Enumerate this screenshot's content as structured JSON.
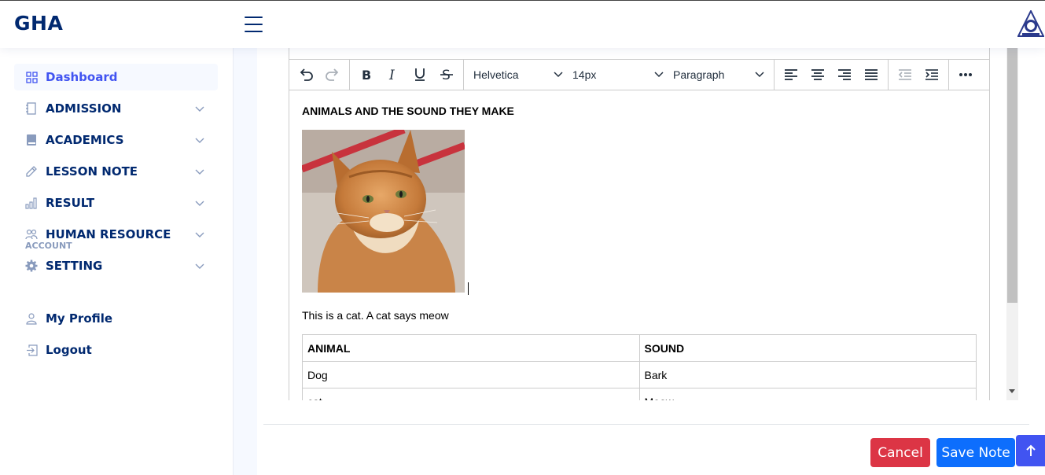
{
  "header": {
    "logo": "GHA"
  },
  "sidebar": {
    "items": [
      {
        "label": "Dashboard",
        "icon": "grid-icon",
        "active": true
      },
      {
        "label": "ADMISSION",
        "icon": "journal-icon"
      },
      {
        "label": "ACADEMICS",
        "icon": "book-icon"
      },
      {
        "label": "LESSON NOTE",
        "icon": "pencil-icon"
      },
      {
        "label": "RESULT",
        "icon": "bar-chart-icon"
      },
      {
        "label": "HUMAN RESOURCE",
        "icon": "people-icon"
      },
      {
        "label": "SETTING",
        "icon": "gear-icon"
      }
    ],
    "account_heading": "ACCOUNT",
    "account_items": [
      {
        "label": "My Profile",
        "icon": "person-icon"
      },
      {
        "label": "Logout",
        "icon": "logout-icon"
      }
    ]
  },
  "editor": {
    "font_family": "Helvetica",
    "font_size": "14px",
    "block_format": "Paragraph",
    "doc_title": "ANIMALS AND THE SOUND THEY MAKE",
    "image_subject": "orange tabby cat",
    "paragraph": "This is a cat. A cat says meow",
    "table": {
      "headers": [
        "ANIMAL",
        "SOUND"
      ],
      "rows": [
        [
          "Dog",
          "Bark"
        ],
        [
          "cat",
          "Meow"
        ]
      ]
    }
  },
  "actions": {
    "cancel": "Cancel",
    "save": "Save Note"
  },
  "colors": {
    "brand": "#012970",
    "accent": "#4154f1",
    "cancel": "#dc3545",
    "save": "#0d6efd"
  }
}
